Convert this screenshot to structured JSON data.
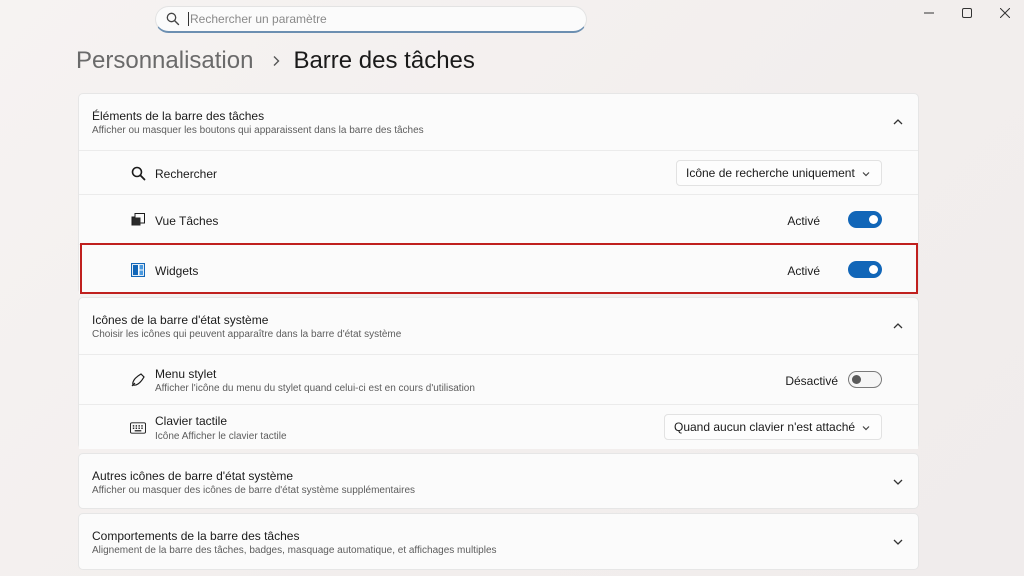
{
  "search": {
    "placeholder": "Rechercher un paramètre"
  },
  "breadcrumb": {
    "parent": "Personnalisation",
    "current": "Barre des tâches"
  },
  "taskbar_items": {
    "title": "Éléments de la barre des tâches",
    "description": "Afficher ou masquer les boutons qui apparaissent dans la barre des tâches",
    "items": [
      {
        "label": "Rechercher",
        "icon": "search-icon",
        "control": "dropdown",
        "value": "Icône de recherche uniquement"
      },
      {
        "label": "Vue Tâches",
        "icon": "task-view-icon",
        "control": "toggle",
        "state": "Activé",
        "on": true
      },
      {
        "label": "Widgets",
        "icon": "widgets-icon",
        "control": "toggle",
        "state": "Activé",
        "on": true
      }
    ]
  },
  "system_tray": {
    "title": "Icônes de la barre d'état système",
    "description": "Choisir les icônes qui peuvent apparaître dans la barre d'état système",
    "items": [
      {
        "label": "Menu stylet",
        "sub": "Afficher l'icône du menu du stylet quand celui-ci est en cours d'utilisation",
        "icon": "pen-icon",
        "control": "toggle",
        "state": "Désactivé",
        "on": false
      },
      {
        "label": "Clavier tactile",
        "sub": "Icône Afficher le clavier tactile",
        "icon": "keyboard-icon",
        "control": "dropdown",
        "value": "Quand aucun clavier n'est attaché"
      }
    ]
  },
  "other_tray": {
    "title": "Autres icônes de barre d'état système",
    "description": "Afficher ou masquer des icônes de barre d'état système supplémentaires"
  },
  "behaviors": {
    "title": "Comportements de la barre des tâches",
    "description": "Alignement de la barre des tâches, badges, masquage automatique, et affichages multiples"
  },
  "colors": {
    "accent": "#1166b8",
    "highlight": "#c0201e"
  }
}
